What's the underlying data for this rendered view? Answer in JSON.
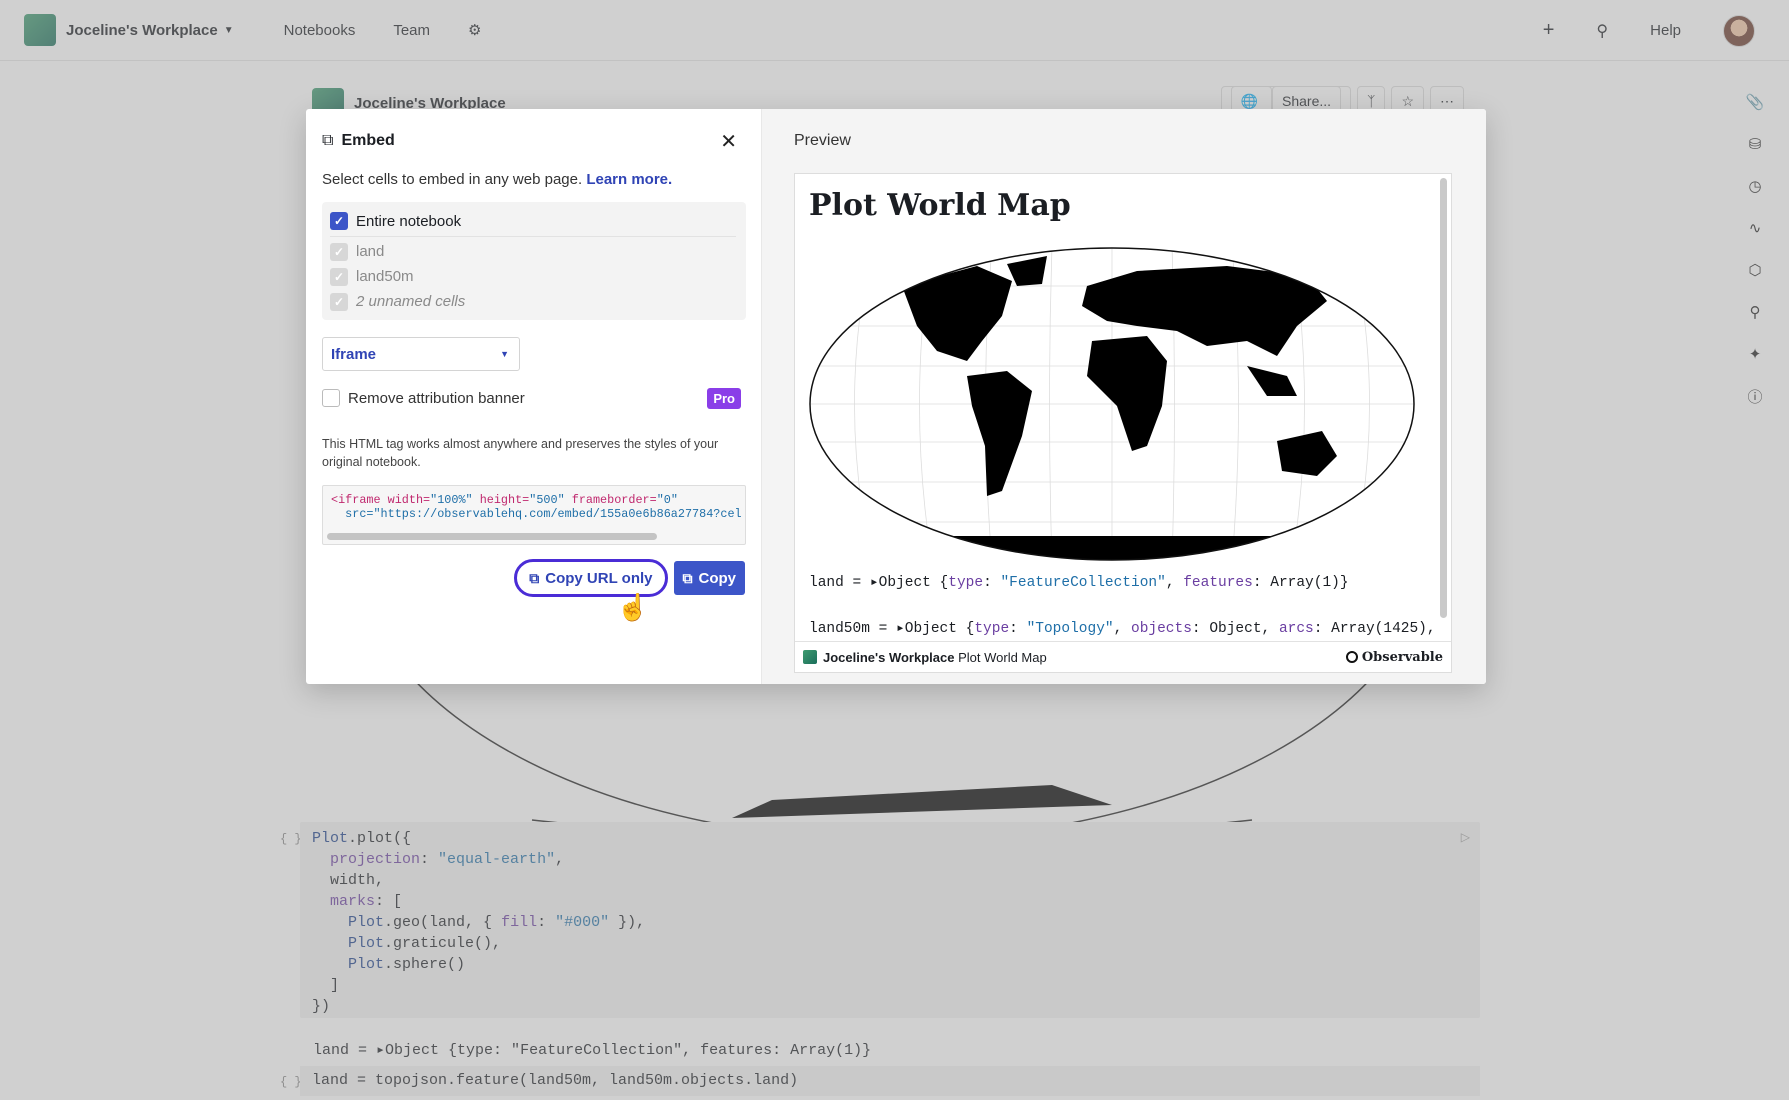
{
  "topbar": {
    "workspace_name": "Joceline's Workplace",
    "nav": [
      "Notebooks",
      "Team"
    ],
    "help_label": "Help"
  },
  "notebook": {
    "title": "Joceline's Workplace",
    "share_label": "Share...",
    "code_lines": [
      "Plot.plot({",
      "  projection: \"equal-earth\",",
      "  width,",
      "  marks: [",
      "    Plot.geo(land, { fill: \"#000\" }),",
      "    Plot.graticule(),",
      "    Plot.sphere()",
      "  ]",
      "})"
    ],
    "output_line": "land = ▸Object {type: \"FeatureCollection\", features: Array(1)}",
    "cell2_line": "land = topojson.feature(land50m, land50m.objects.land)"
  },
  "embed": {
    "title": "Embed",
    "intro_text": "Select cells to embed in any web page.",
    "learn_more": "Learn more.",
    "entire_notebook": "Entire notebook",
    "cells": [
      "land",
      "land50m",
      "2 unnamed cells"
    ],
    "format_select": "Iframe",
    "remove_banner_label": "Remove attribution banner",
    "pro_badge": "Pro",
    "description": "This HTML tag works almost anywhere and preserves the styles of your original notebook.",
    "code_line1_tag": "<iframe",
    "code_line1_attrs": " width=\"100%\" height=\"500\" frameborder=\"0\"",
    "code_line2": "  src=\"https://observablehq.com/embed/155a0e6b86a27784?cel",
    "copy_url_label": "Copy URL only",
    "copy_label": "Copy"
  },
  "preview": {
    "label": "Preview",
    "title": "Plot World Map",
    "out1": "land = ▸Object {type: \"FeatureCollection\", features: Array(1)}",
    "out2": "land50m = ▸Object {type: \"Topology\", objects: Object, arcs: Array(1425),",
    "footer_workspace": "Joceline's Workplace",
    "footer_title": "Plot World Map",
    "brand": "Observable"
  },
  "colors": {
    "accent": "#3c55c8",
    "focus_ring": "#4a2cd6",
    "pro": "#8a3ee8"
  },
  "icons": [
    "chevron-down-icon",
    "gear-icon",
    "plus-icon",
    "search-icon",
    "avatar",
    "paperclip-icon",
    "database-icon",
    "clock-icon",
    "link-icon",
    "cube-icon",
    "search-icon",
    "sparkle-icon",
    "help-icon",
    "copy-icon",
    "close-icon",
    "hand-cursor-icon"
  ]
}
